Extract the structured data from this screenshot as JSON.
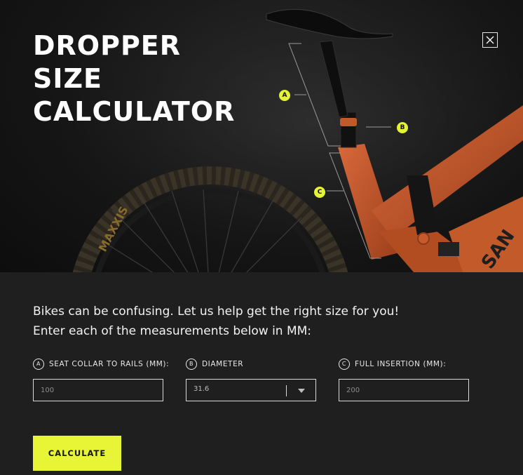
{
  "modal": {
    "title_lines": [
      "DROPPER",
      "SIZE",
      "CALCULATOR"
    ],
    "close_label": "×"
  },
  "hero": {
    "markers": {
      "a": "A",
      "b": "B",
      "c": "C"
    },
    "tire_brand": "MAXXIS",
    "frame_brand": "SAN",
    "accent_color": "#e5f236",
    "frame_color": "#c85a2a"
  },
  "intro": {
    "line1": "Bikes can be confusing. Let us help get the right size for you!",
    "line2": "Enter each of the measurements below in MM:"
  },
  "fields": {
    "seat_collar": {
      "marker": "A",
      "label": "SEAT COLLAR TO RAILS (MM):",
      "placeholder": "100"
    },
    "diameter": {
      "marker": "B",
      "label": "DIAMETER",
      "value": "31.6"
    },
    "full_insertion": {
      "marker": "C",
      "label": "FULL INSERTION (MM):",
      "placeholder": "200"
    }
  },
  "actions": {
    "calculate_label": "CALCULATE"
  }
}
